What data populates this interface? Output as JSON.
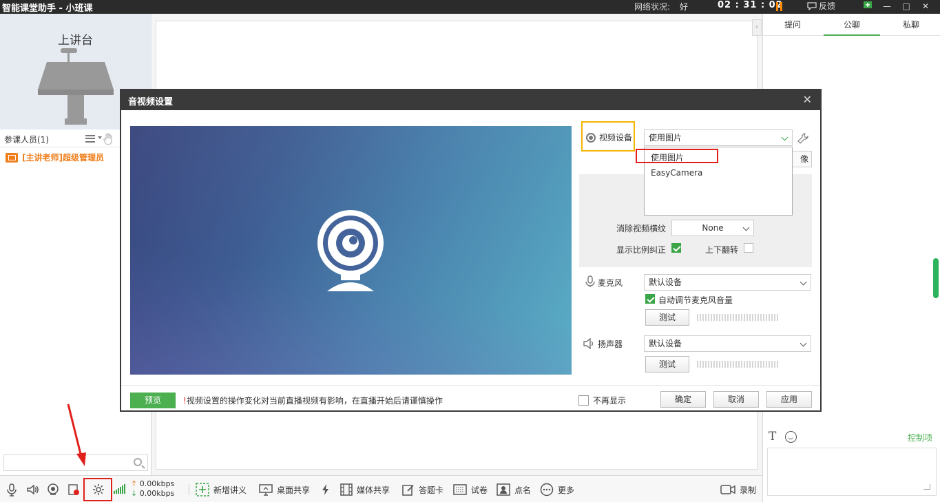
{
  "titlebar": {
    "app_title": "智能课堂助手 - 小班课",
    "network_label": "网络状况:",
    "network_value": "好",
    "timer": "02 : 31 : 02",
    "feedback": "反馈"
  },
  "left_panel": {
    "podium_title": "上讲台",
    "participants_label": "参课人员(1)",
    "teacher_name": "[主讲老师]超级管理员",
    "search_placeholder": ""
  },
  "right_panel": {
    "tabs": [
      {
        "label": "提问",
        "active": false
      },
      {
        "label": "公聊",
        "active": true
      },
      {
        "label": "私聊",
        "active": false
      }
    ],
    "font_glyph": "T",
    "control_link": "控制项"
  },
  "bottom_bar": {
    "upload_rate": "0.00kbps",
    "download_rate": "0.00kbps",
    "items": [
      {
        "label": "新增讲义"
      },
      {
        "label": "桌面共享"
      },
      {
        "label": "媒体共享"
      },
      {
        "label": "答题卡"
      },
      {
        "label": "试卷"
      },
      {
        "label": "点名"
      },
      {
        "label": "更多"
      },
      {
        "label": "录制"
      }
    ]
  },
  "dialog": {
    "title": "音视频设置",
    "video_device_label": "视频设备",
    "video_device_value": "使用图片",
    "dropdown_options": [
      "使用图片",
      "EasyCamera"
    ],
    "hidden_button_tail": "像",
    "deinterlace_label": "消除视频横纹",
    "deinterlace_value": "None",
    "aspect_label": "显示比例纠正",
    "aspect_checked": true,
    "flip_label": "上下翻转",
    "flip_checked": false,
    "mic_label": "麦克风",
    "mic_value": "默认设备",
    "auto_gain_label": "自动调节麦克风音量",
    "auto_gain_checked": true,
    "test_label": "测试",
    "speaker_label": "扬声器",
    "speaker_value": "默认设备",
    "preview_label": "预览",
    "warning_mark": "!",
    "warning_text": "视频设置的操作变化对当前直播视频有影响，在直播开始后请谨慎操作",
    "no_show_label": "不再显示",
    "ok_label": "确定",
    "cancel_label": "取消",
    "apply_label": "应用"
  },
  "colors": {
    "accent_green": "#4caf50",
    "highlight_red": "#e0201b",
    "highlight_yellow": "#f5b400",
    "teacher_orange": "#f07e1b"
  }
}
